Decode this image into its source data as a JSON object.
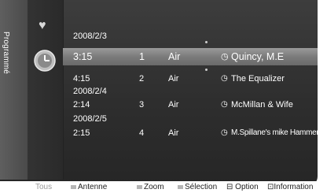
{
  "side_tab": {
    "label": "Programmé"
  },
  "icons": {
    "favorite": "heart-icon",
    "timer": "clock-icon",
    "reminder": "clock-small-icon"
  },
  "schedule": {
    "groups": [
      {
        "date": "2008/2/3",
        "rows": [
          {
            "time": "3:15",
            "channel": "1",
            "antenna": "Air",
            "title": "Quincy, M.E",
            "selected": true
          }
        ]
      },
      {
        "date": "",
        "rows": [
          {
            "time": "4:15",
            "channel": "2",
            "antenna": "Air",
            "title": "The Equalizer",
            "selected": false
          }
        ]
      },
      {
        "date": "2008/2/4",
        "rows": [
          {
            "time": "2:14",
            "channel": "3",
            "antenna": "Air",
            "title": "McMillan & Wife",
            "selected": false
          }
        ]
      },
      {
        "date": "2008/2/5",
        "rows": [
          {
            "time": "2:15",
            "channel": "4",
            "antenna": "Air",
            "title": "M.Spillane's mike Hammer",
            "selected": false
          }
        ]
      }
    ]
  },
  "bottom_bar": {
    "tous": "Tous",
    "antenne": "Antenne",
    "zoom": "Zoom",
    "selection": "Sélection",
    "option": "Option",
    "information": "Information"
  },
  "colors": {
    "panel": "#2e2e2e",
    "highlight": "#8a8a8a",
    "text": "#ffffff"
  }
}
